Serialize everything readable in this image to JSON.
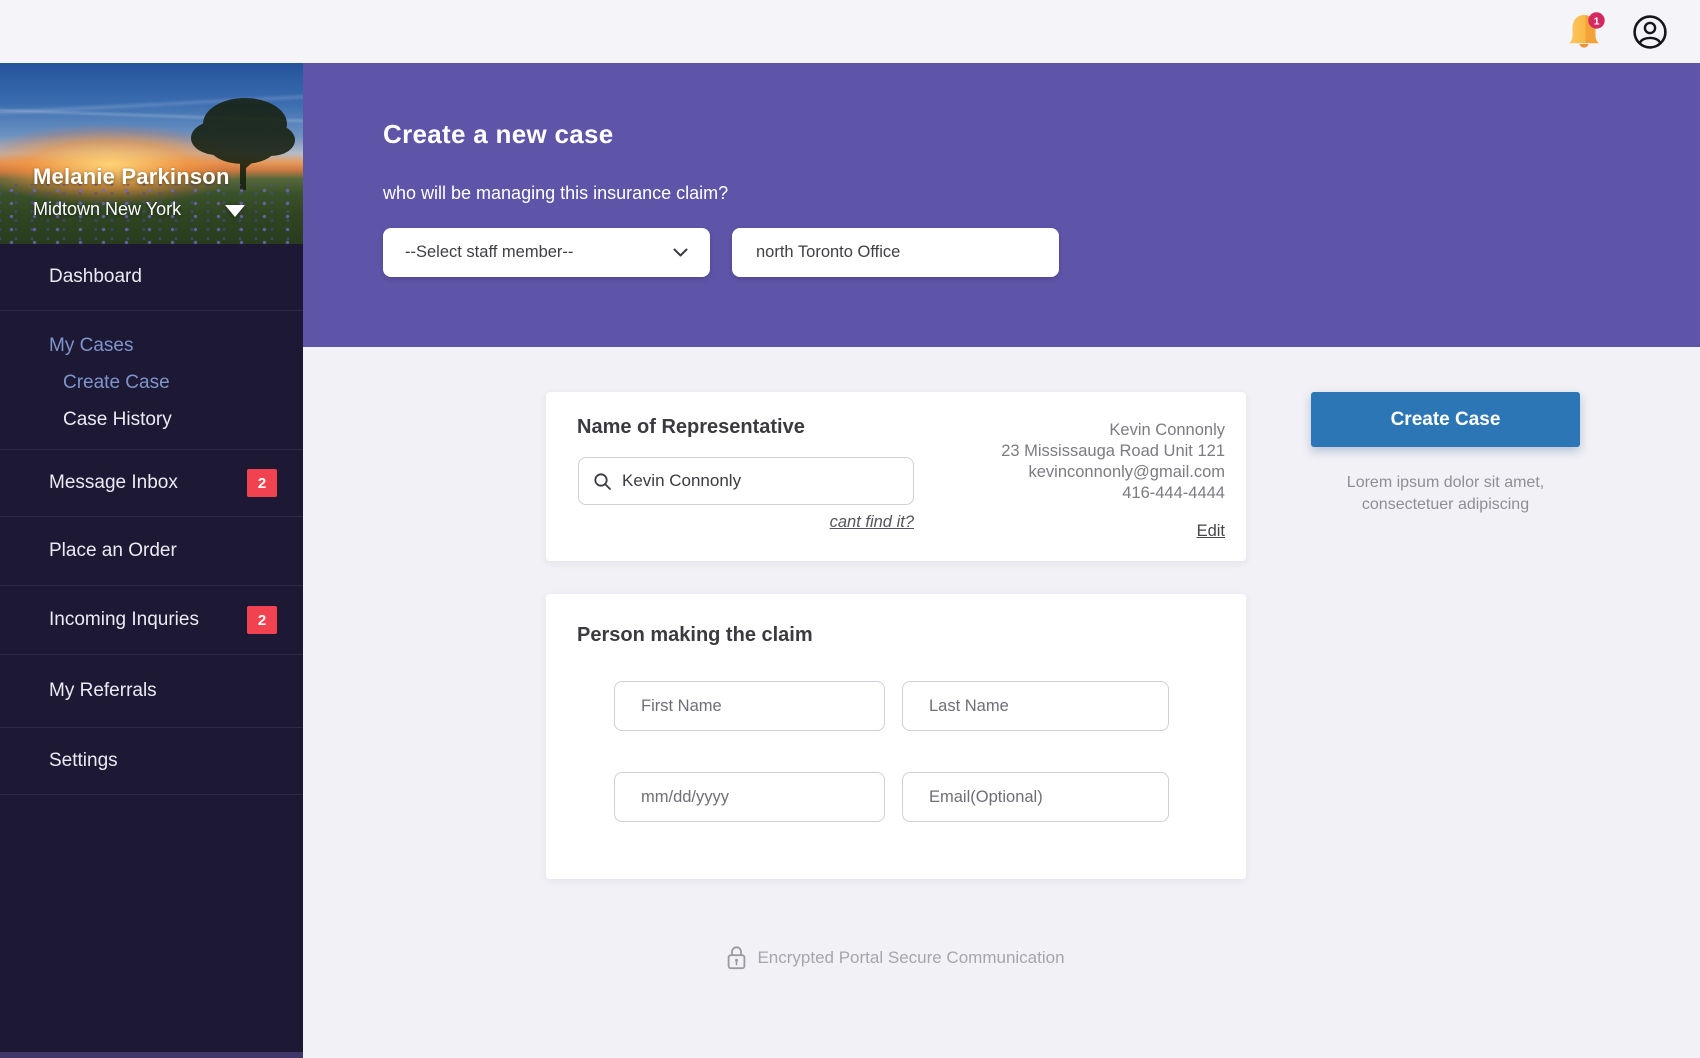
{
  "topbar": {
    "notification_count": "1"
  },
  "sidebar": {
    "profile": {
      "name": "Melanie Parkinson",
      "location": "Midtown New York"
    },
    "nav": [
      {
        "label": "Dashboard"
      },
      {
        "label": "My Cases"
      },
      {
        "label": "Create Case"
      },
      {
        "label": "Case History"
      },
      {
        "label": "Message Inbox",
        "badge": "2"
      },
      {
        "label": "Place an Order"
      },
      {
        "label": "Incoming Inquries",
        "badge": "2"
      },
      {
        "label": "My Referrals"
      },
      {
        "label": "Settings"
      }
    ]
  },
  "hero": {
    "title": "Create a new case",
    "subtitle": "who will be managing this insurance claim?",
    "staff_select_value": "--Select staff member--",
    "office_value": "north Toronto Office"
  },
  "representative": {
    "heading": "Name of Representative",
    "search_value": "Kevin Connonly",
    "cant_find_link": "cant find it?",
    "info": {
      "name": "Kevin Connonly",
      "address": "23 Mississauga Road Unit 121",
      "email": "kevinconnonly@gmail.com",
      "phone": "416-444-4444",
      "edit_link": "Edit"
    }
  },
  "create_case": {
    "button_label": "Create Case",
    "description_line1": "Lorem ipsum dolor sit amet,",
    "description_line2": "consectetuer adipiscing"
  },
  "claim": {
    "heading": "Person making the claim",
    "first_name_placeholder": "First Name",
    "last_name_placeholder": "Last Name",
    "dob_placeholder": "mm/dd/yyyy",
    "email_placeholder": "Email(Optional)"
  },
  "footer": {
    "secure_text": "Encrypted Portal Secure Communication"
  },
  "colors": {
    "purple": "#5e54a8",
    "sidebar": "#1d1935",
    "accent_blue": "#2d76b5",
    "badge_red": "#f0434f"
  }
}
